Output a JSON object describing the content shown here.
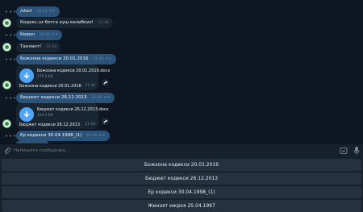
{
  "messages": [
    {
      "kind": "in",
      "text": "/start",
      "time": "21:44",
      "checked": true
    },
    {
      "kind": "in",
      "text": "Кодекс.uz ботга хуш келибсиз!",
      "time": "21:44"
    },
    {
      "kind": "in",
      "text": "Кирил",
      "time": "21:44",
      "checked": true
    },
    {
      "kind": "in",
      "text": "Танлант!",
      "time": "21:44"
    },
    {
      "kind": "out",
      "text": "Божхона кодекси 20.01.2016",
      "time": "21:44",
      "checked": true
    },
    {
      "kind": "file",
      "name": "Божхона кодекси 20.01.2016.docx",
      "size": "279.0 KB",
      "caption": "Божхона кодекси 20.01.2016",
      "time": "21:44"
    },
    {
      "kind": "out",
      "text": "Бюджет кодекси 26.12.2013",
      "time": "21:44",
      "checked": true
    },
    {
      "kind": "file",
      "name": "Бюджет кодекси 26.12.2013.docx",
      "size": "204.4 KB",
      "caption": "Бюджет кодекси 26.12.2013",
      "time": "21:44"
    },
    {
      "kind": "out",
      "text": "Ер кодекси 30.04.1998_(1)",
      "time": "21:44",
      "checked": true
    }
  ],
  "composer": {
    "placeholder": "Напишите сообщение..."
  },
  "keyboard": {
    "buttons": [
      "Божхона кодекси 20.01.2016",
      "Бюджет кодекси 26.12.2013",
      "Ер кодекси 30.04.1998_(1)",
      "Жиноят ижроя 25.04.1997"
    ]
  },
  "colors": {
    "background": "#0e1621",
    "bubble_out": "#2b5278",
    "bubble_in": "#182533",
    "accent": "#4ea4f6",
    "keyboard_button": "#243240"
  },
  "icons": [
    "attach-icon",
    "keyboard-icon",
    "mic-icon",
    "download-icon",
    "share-icon",
    "check-icon"
  ]
}
